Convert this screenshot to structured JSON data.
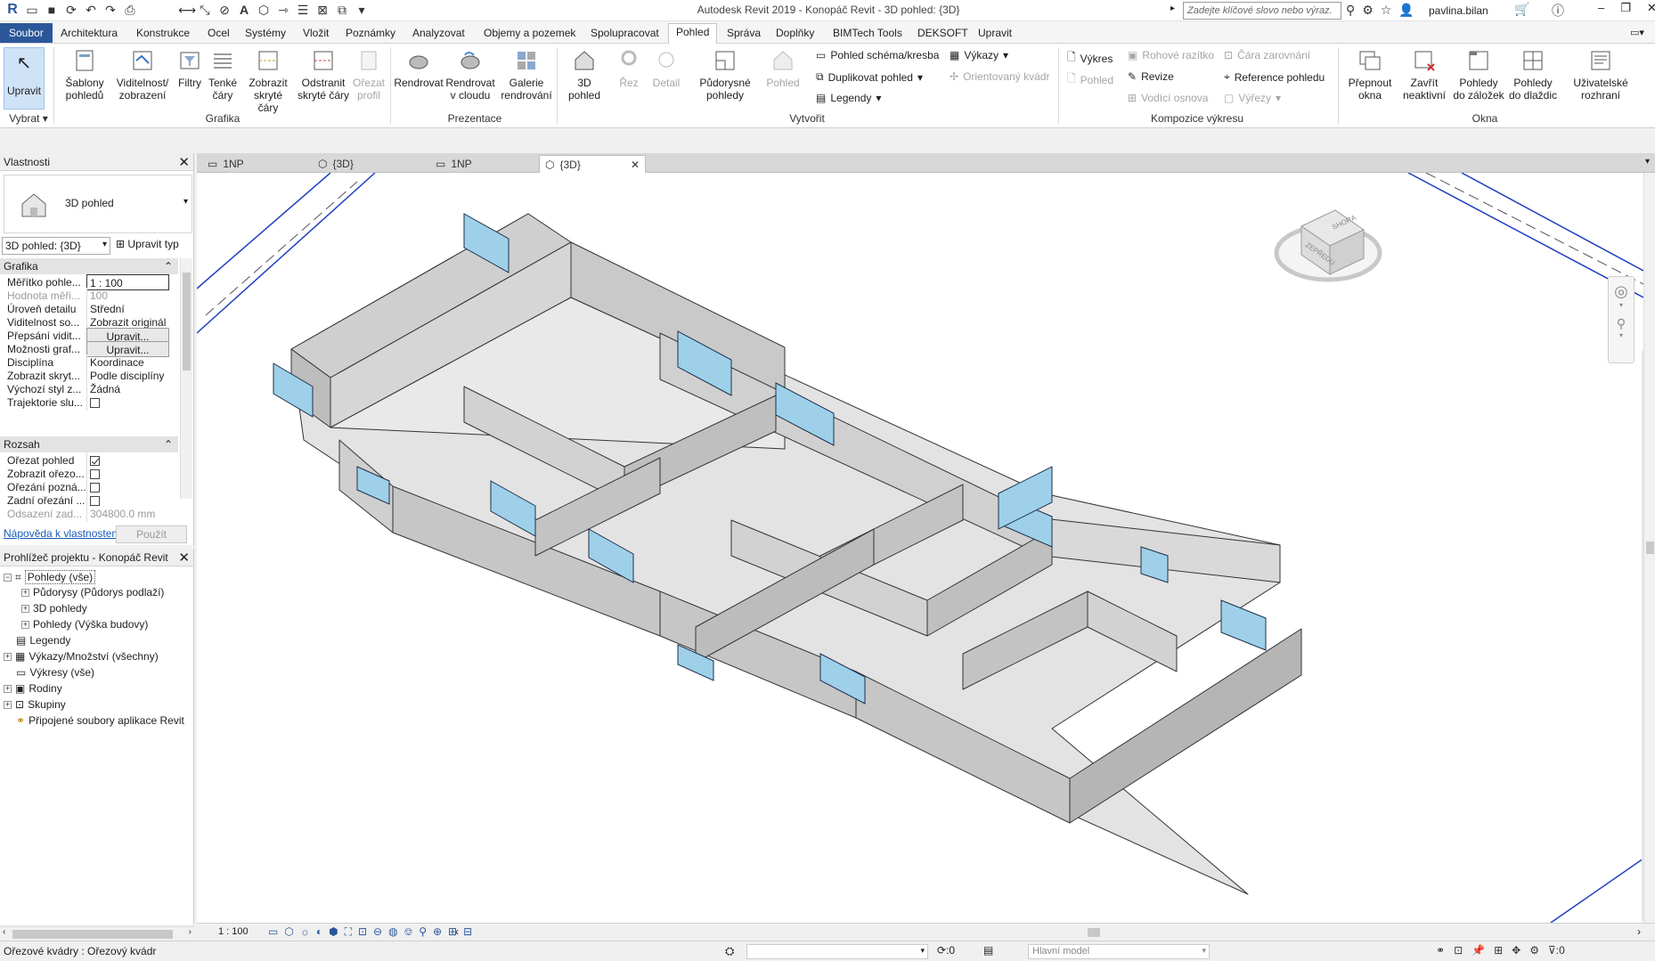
{
  "app": {
    "title": "Autodesk Revit 2019 - Konopáč Revit - 3D pohled: {3D}"
  },
  "search": {
    "placeholder": "Zadejte klíčové slovo nebo výraz."
  },
  "user": {
    "name": "pavlina.bilan"
  },
  "menu_tabs": [
    "Soubor",
    "Architektura",
    "Konstrukce",
    "Ocel",
    "Systémy",
    "Vložit",
    "Poznámky",
    "Analyzovat",
    "Objemy a pozemek",
    "Spolupracovat",
    "Pohled",
    "Správa",
    "Doplňky",
    "BIMTech Tools",
    "DEKSOFT",
    "Upravit"
  ],
  "active_tab": "Pohled",
  "ribbon": {
    "modify": {
      "label": "Upravit",
      "select": "Vybrat"
    },
    "graphics": {
      "panel": "Grafika",
      "templates": "Šablony\npohledů",
      "visibility": "Viditelnost/\nzobrazení",
      "filters": "Filtry",
      "thin_lines": "Tenké\nčáry",
      "show_hidden": "Zobrazit\nskryté čáry",
      "remove_hidden": "Odstranit\nskryté čáry",
      "cut_profile": "Ořezat\nprofil"
    },
    "presentation": {
      "panel": "Prezentace",
      "render": "Rendrovat",
      "render_cloud": "Rendrovat\nv cloudu",
      "gallery": "Galerie\nrendrování"
    },
    "create": {
      "panel": "Vytvořit",
      "view3d": "3D\npohled",
      "section": "Řez",
      "callout": "Detail",
      "plan_views": "Půdorysné\npohledy",
      "elevation": "Pohled",
      "drafting": "Pohled schéma/kresba",
      "duplicate": "Duplikovat pohled",
      "legends": "Legendy",
      "schedules": "Výkazy",
      "scope_box": "Orientovaný kvádr"
    },
    "sheet": {
      "panel": "Kompozice výkresu",
      "sheet": "Výkres",
      "view": "Pohled",
      "title_block": "Rohové razítko",
      "revisions": "Revize",
      "guide_grid": "Vodící osnova",
      "matchline": "Čára zarovnání",
      "view_ref": "Reference pohledu",
      "viewports": "Výřezy"
    },
    "windows": {
      "panel": "Okna",
      "switch": "Přepnout\nokna",
      "close_inactive": "Zavřít\nneaktivní",
      "tab_views": "Pohledy\ndo záložek",
      "tile_views": "Pohledy\ndo dlaždic",
      "ui": "Uživatelské\nrozhraní"
    }
  },
  "properties": {
    "title": "Vlastnosti",
    "type_name": "3D pohled",
    "selector": "3D pohled: {3D}",
    "edit_type": "Upravit typ",
    "sections": {
      "graphics": "Grafika",
      "extents": "Rozsah"
    },
    "rows": [
      {
        "k": "Měřítko pohle...",
        "v": "1 : 100"
      },
      {
        "k": "Hodnota měři...",
        "v": "100"
      },
      {
        "k": "Úroveň detailu",
        "v": "Střední"
      },
      {
        "k": "Viditelnost so...",
        "v": "Zobrazit originál"
      },
      {
        "k": "Přepsání vidit...",
        "v": "Upravit..."
      },
      {
        "k": "Možnosti graf...",
        "v": "Upravit..."
      },
      {
        "k": "Disciplína",
        "v": "Koordinace"
      },
      {
        "k": "Zobrazit skryt...",
        "v": "Podle disciplíny"
      },
      {
        "k": "Výchozí styl z...",
        "v": "Žádná"
      },
      {
        "k": "Trajektorie slu...",
        "v": ""
      }
    ],
    "extent_rows": [
      {
        "k": "Ořezat pohled",
        "v": "checked"
      },
      {
        "k": "Zobrazit ořezo...",
        "v": ""
      },
      {
        "k": "Ořezání pozná...",
        "v": ""
      },
      {
        "k": "Zadní ořezání ...",
        "v": ""
      },
      {
        "k": "Odsazení zad...",
        "v": "304800.0 mm"
      }
    ],
    "help": "Nápověda k vlastnostem",
    "apply": "Použít"
  },
  "browser": {
    "title": "Prohlížeč projektu - Konopáč Revit",
    "items": [
      "Pohledy (vše)",
      "Půdorysy (Půdorys podlaží)",
      "3D pohledy",
      "Pohledy (Výška budovy)",
      "Legendy",
      "Výkazy/Množství (všechny)",
      "Výkresy (vše)",
      "Rodiny",
      "Skupiny",
      "Připojené soubory aplikace Revit"
    ]
  },
  "doc_tabs": [
    "1NP",
    "{3D}",
    "1NP",
    "{3D}"
  ],
  "viewcube": {
    "top": "SHORA",
    "front": "ZEPŘEDU"
  },
  "view_control": {
    "scale": "1 : 100"
  },
  "status": {
    "text": "Ořezové kvádry : Ořezový kvádr",
    "model": "Hlavní model",
    "worksets": ":0",
    "filter": ":0"
  },
  "colors": {
    "file_tab": "#2b579a",
    "wall": "#d9d9d9",
    "glass": "#9fd0ea",
    "model_line": "#1f3fbf"
  }
}
